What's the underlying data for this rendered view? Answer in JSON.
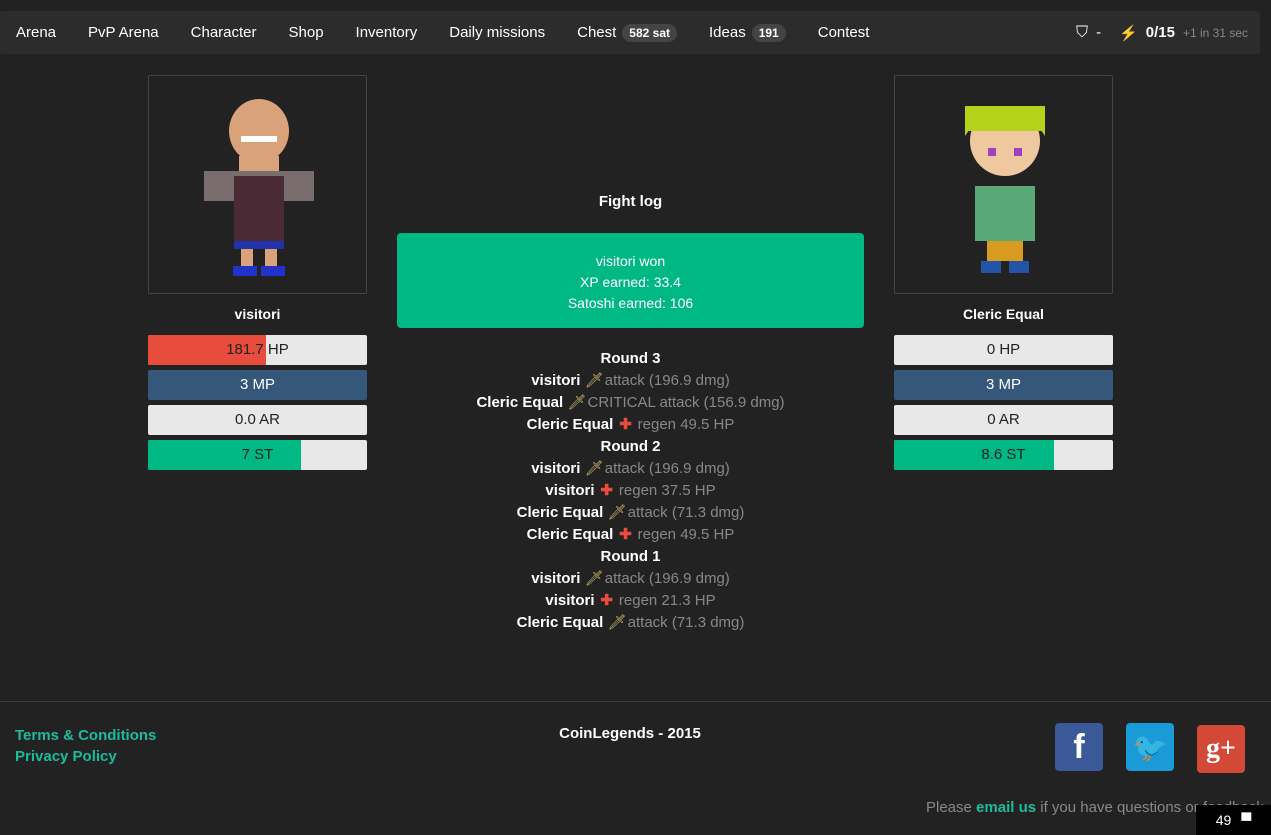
{
  "nav": {
    "items": [
      {
        "label": "Arena"
      },
      {
        "label": "PvP Arena"
      },
      {
        "label": "Character"
      },
      {
        "label": "Shop"
      },
      {
        "label": "Inventory"
      },
      {
        "label": "Daily missions"
      },
      {
        "label": "Chest",
        "badge": "582 sat"
      },
      {
        "label": "Ideas",
        "badge": "191"
      },
      {
        "label": "Contest"
      }
    ],
    "shield_value": "-",
    "energy": "0/15",
    "energy_regen": "+1 in 31 sec"
  },
  "player": {
    "name": "visitori",
    "hp": "181.7 HP",
    "hp_fraction": 0.54,
    "mp": "3 MP",
    "ar": "0.0 AR",
    "st": "7 ST",
    "st_fraction": 0.7
  },
  "opponent": {
    "name": "Cleric Equal",
    "hp": "0 HP",
    "hp_fraction": 0,
    "mp": "3 MP",
    "ar": "0 AR",
    "st": "8.6 ST",
    "st_fraction": 0.73
  },
  "colors": {
    "hp": "#e74c3c",
    "mp": "#34577a",
    "st": "#00b884",
    "accent": "#1abc9c"
  },
  "fight": {
    "title": "Fight log",
    "result": [
      "visitori won",
      "XP earned: 33.4",
      "Satoshi earned: 106"
    ],
    "log": [
      {
        "round": "Round 3"
      },
      {
        "actor": "visitori",
        "icon": "sword",
        "text": "attack (196.9 dmg)"
      },
      {
        "actor": "Cleric Equal",
        "icon": "sword",
        "text": "CRITICAL attack (156.9 dmg)"
      },
      {
        "actor": "Cleric Equal",
        "icon": "cross",
        "text": "regen 49.5 HP"
      },
      {
        "round": "Round 2"
      },
      {
        "actor": "visitori",
        "icon": "sword",
        "text": "attack (196.9 dmg)"
      },
      {
        "actor": "visitori",
        "icon": "cross",
        "text": "regen 37.5 HP"
      },
      {
        "actor": "Cleric Equal",
        "icon": "sword",
        "text": "attack (71.3 dmg)"
      },
      {
        "actor": "Cleric Equal",
        "icon": "cross",
        "text": "regen 49.5 HP"
      },
      {
        "round": "Round 1"
      },
      {
        "actor": "visitori",
        "icon": "sword",
        "text": "attack (196.9 dmg)"
      },
      {
        "actor": "visitori",
        "icon": "cross",
        "text": "regen 21.3 HP"
      },
      {
        "actor": "Cleric Equal",
        "icon": "sword",
        "text": "attack (71.3 dmg)"
      }
    ]
  },
  "footer": {
    "terms": "Terms & Conditions",
    "privacy": "Privacy Policy",
    "copyright": "CoinLegends - 2015",
    "contact_pre": "Please ",
    "contact_link": "email us",
    "contact_post": " if you have questions or feedback.",
    "chat_count": "49"
  }
}
